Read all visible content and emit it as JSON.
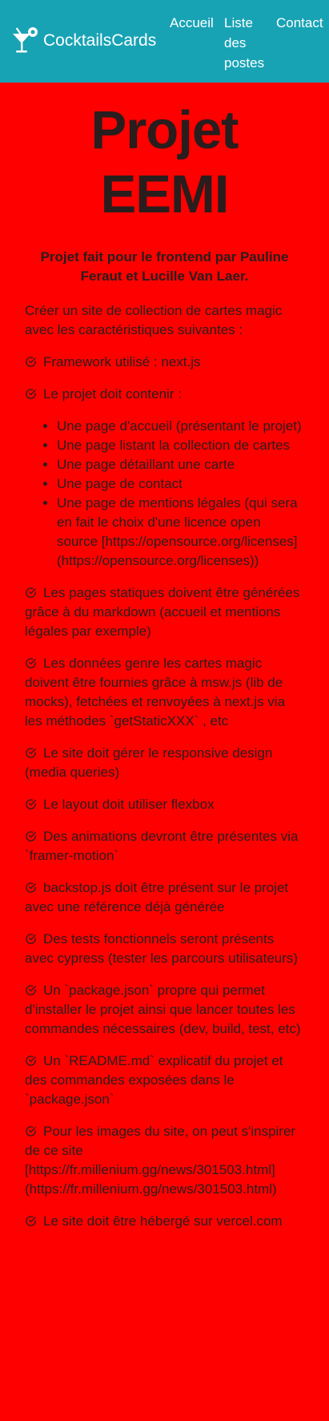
{
  "navbar": {
    "brand": "CocktailsCards",
    "links": [
      "Accueil",
      "Liste des postes",
      "Contact"
    ]
  },
  "main": {
    "title": "Projet EEMI",
    "subtitle": "Projet fait pour le frontend par Pauline Feraut et Lucille Van Laer.",
    "intro": "Créer un site de collection de cartes magic avec les caractéristiques suivantes :",
    "requirements": [
      "Framework utilisé : next.js",
      "Le projet doit contenir :",
      "Les pages statiques doivent être générées grâce à du markdown (accueil et mentions légales par exemple)",
      "Les données genre les cartes magic doivent être fournies grâce à msw.js (lib de mocks), fetchées et renvoyées à next.js via les méthodes `getStaticXXX` , etc",
      "Le site doit gérer le responsive design (media queries)",
      "Le layout doit utiliser flexbox",
      "Des animations devront être présentes via `framer-motion`",
      "backstop.js doit être présent sur le projet avec une référence déjà générée",
      "Des tests fonctionnels seront présents avec cypress (tester les parcours utilisateurs)",
      "Un `package.json` propre qui permet d'installer le projet ainsi que lancer toutes les commandes nécessaires (dev, build, test, etc)",
      "Un `README.md` explicatif du projet et des commandes exposées dans le `package.json`",
      "Pour les images du site, on peut s'inspirer de ce site [https://fr.millenium.gg/news/301503.html](https://fr.millenium.gg/news/301503.html)",
      "Le site doit être hébergé sur vercel.com"
    ],
    "pages": [
      "Une page d'accueil (présentant le projet)",
      "Une page listant la collection de cartes",
      "Une page détaillant une carte",
      "Une page de contact",
      "Une page de mentions légales (qui sera en fait le choix d'une licence open source [https://opensource.org/licenses](https://opensource.org/licenses))"
    ]
  },
  "colors": {
    "navbar": "#18a3b5",
    "background": "#ff0000",
    "text": "#2a1d1d"
  },
  "icons": {
    "brand": "cocktail-glass-icon",
    "requirement": "circle-check-icon"
  }
}
